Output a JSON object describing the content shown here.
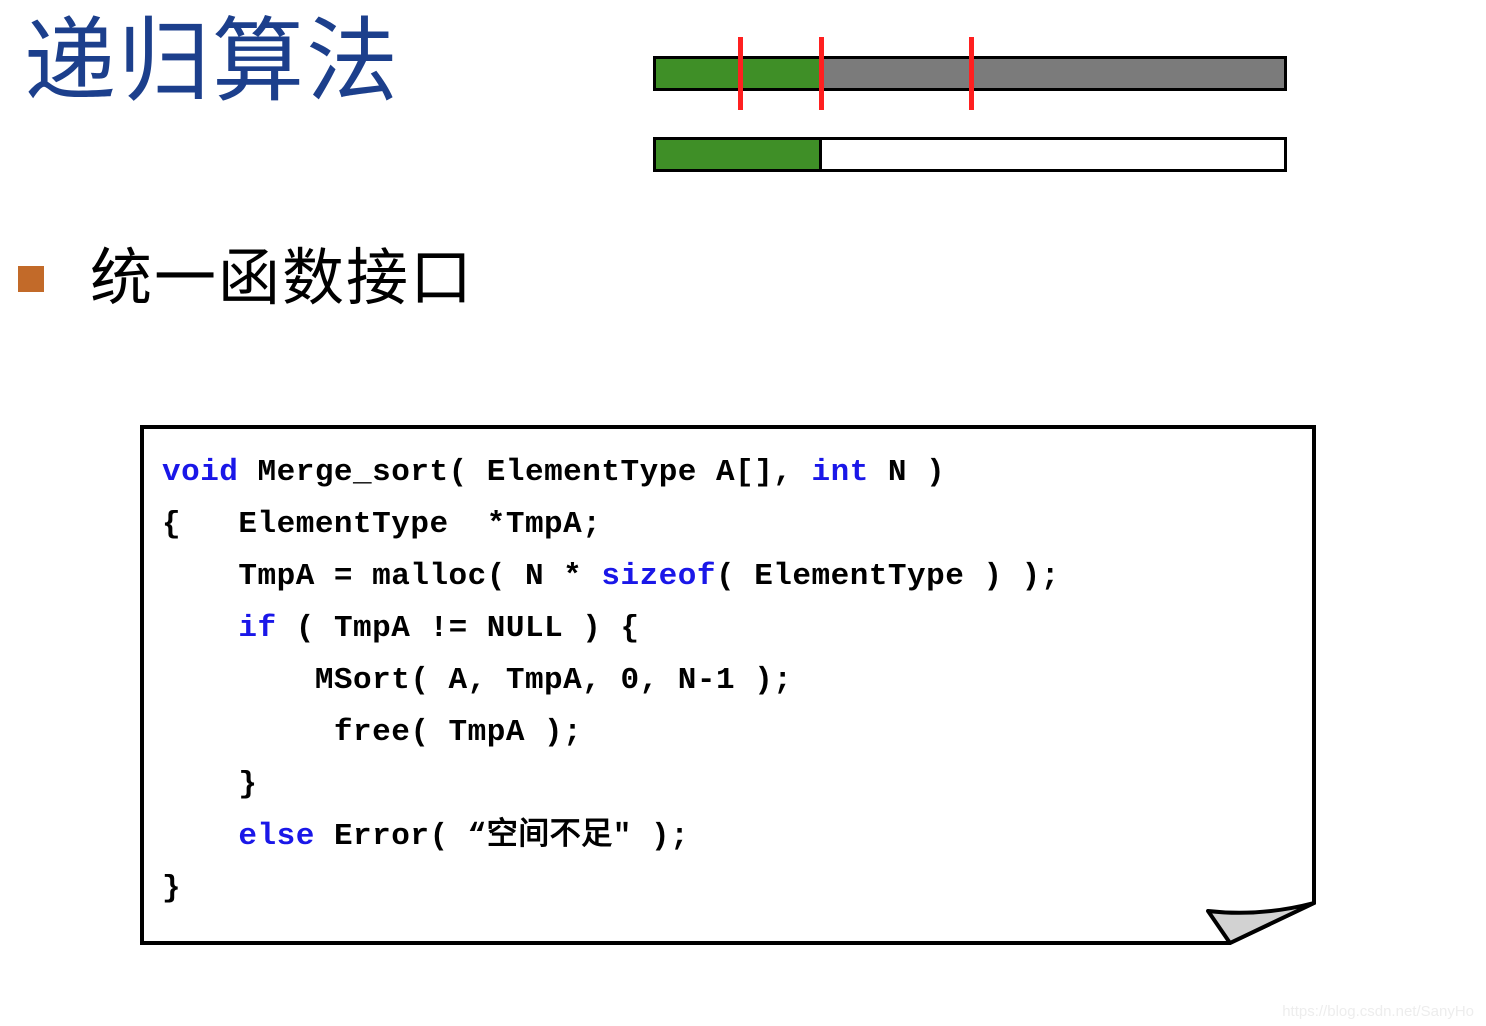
{
  "slide": {
    "title": "递归算法",
    "title_color": "#1C3F8C",
    "background_color": "#ffffff"
  },
  "bullet": {
    "marker_icon": "square-bullet-icon",
    "marker_color": "#C26A29",
    "text": "统一函数接口"
  },
  "diagram": {
    "name": "merge-sort-array-bars",
    "colors": {
      "green": "#3F8F27",
      "gray": "#7B7B7B",
      "white": "#ffffff",
      "outline": "#000000",
      "tick": "#FF2020"
    },
    "bars": [
      {
        "label": "top-bar",
        "segments": [
          {
            "fill": "green",
            "width_pct": 26.5
          },
          {
            "fill": "gray",
            "width_pct": 73.5
          }
        ]
      },
      {
        "label": "bottom-bar",
        "segments": [
          {
            "fill": "green",
            "width_pct": 26.5
          },
          {
            "fill": "white",
            "width_pct": 73.5
          }
        ]
      }
    ],
    "tick_markers": [
      {
        "name": "tick-1",
        "left_pct": 13.7
      },
      {
        "name": "tick-2",
        "left_pct": 26.5
      },
      {
        "name": "tick-3",
        "left_pct": 50.2
      }
    ]
  },
  "code": {
    "keyword_color": "#1A17E8",
    "text_color": "#000000",
    "lines": [
      [
        {
          "t": "void",
          "kw": true
        },
        {
          "t": " Merge_sort( ElementType A[], ",
          "kw": false
        },
        {
          "t": "int",
          "kw": true
        },
        {
          "t": " N )",
          "kw": false
        }
      ],
      [
        {
          "t": "{   ElementType  *TmpA;",
          "kw": false
        }
      ],
      [
        {
          "t": "    TmpA = malloc( N * ",
          "kw": false
        },
        {
          "t": "sizeof",
          "kw": true
        },
        {
          "t": "( ElementType ) );",
          "kw": false
        }
      ],
      [
        {
          "t": "    ",
          "kw": false
        },
        {
          "t": "if",
          "kw": true
        },
        {
          "t": " ( TmpA != NULL ) {",
          "kw": false
        }
      ],
      [
        {
          "t": "        MSort( A, TmpA, 0, N-1 );",
          "kw": false
        }
      ],
      [
        {
          "t": "         free( TmpA );",
          "kw": false
        }
      ],
      [
        {
          "t": "    }",
          "kw": false
        }
      ],
      [
        {
          "t": "    ",
          "kw": false
        },
        {
          "t": "else",
          "kw": true
        },
        {
          "t": " Error( “空间不足\" );",
          "kw": false
        }
      ],
      [
        {
          "t": "}",
          "kw": false
        }
      ]
    ]
  },
  "watermark": {
    "text": "https://blog.csdn.net/SanyHo"
  }
}
